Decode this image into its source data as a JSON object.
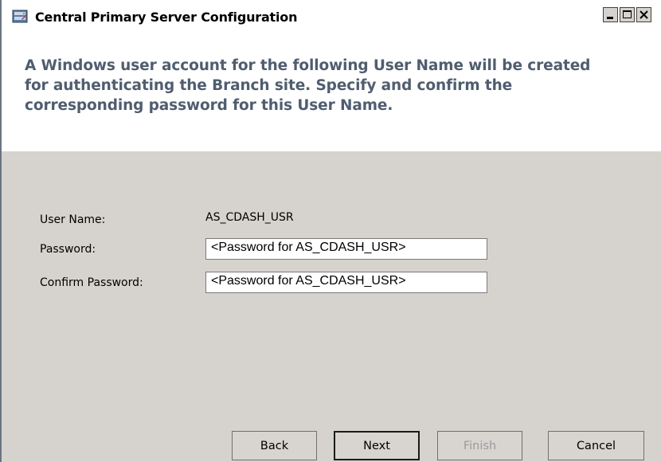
{
  "window": {
    "title": "Central Primary Server Configuration",
    "controls": [
      "minimize-icon",
      "maximize-icon",
      "close-icon"
    ]
  },
  "header": {
    "instruction": "A Windows user account for the following User Name will be created for authenticating the Branch site. Specify and confirm the corresponding password for this User Name."
  },
  "form": {
    "user_name_label": "User Name:",
    "user_name_value": "AS_CDASH_USR",
    "password_label": "Password:",
    "password_value": "<Password for AS_CDASH_USR>",
    "confirm_label": "Confirm Password:",
    "confirm_value": "<Password for AS_CDASH_USR>"
  },
  "buttons": {
    "back": "Back",
    "next": "Next",
    "finish": "Finish",
    "cancel": "Cancel"
  }
}
